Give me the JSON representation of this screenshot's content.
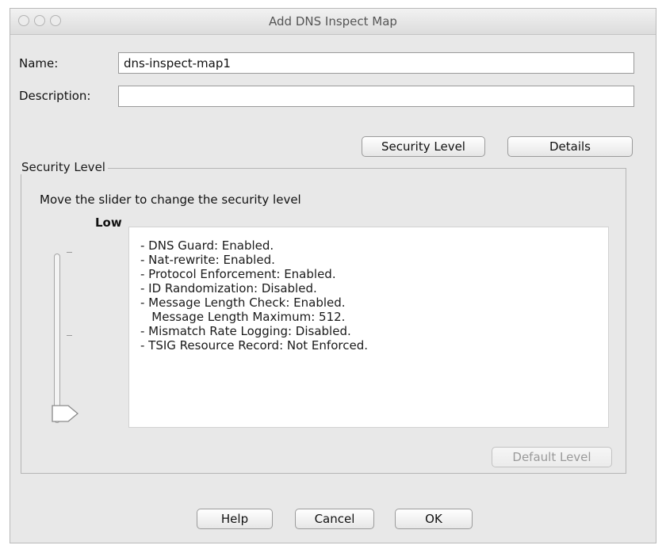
{
  "window": {
    "title": "Add DNS Inspect Map"
  },
  "form": {
    "name_label": "Name:",
    "name_value": "dns-inspect-map1",
    "description_label": "Description:",
    "description_value": ""
  },
  "toolbar": {
    "security_level_label": "Security Level",
    "details_label": "Details"
  },
  "security": {
    "legend": "Security Level",
    "instruction": "Move the slider to change the security level",
    "level": "Low",
    "lines": [
      "- DNS Guard: Enabled.",
      "- Nat-rewrite: Enabled.",
      "- Protocol Enforcement: Enabled.",
      "- ID Randomization: Disabled.",
      "- Message Length Check: Enabled.",
      "   Message Length Maximum: 512.",
      "- Mismatch Rate Logging: Disabled.",
      "- TSIG Resource Record: Not Enforced."
    ],
    "default_level_label": "Default Level"
  },
  "footer": {
    "help_label": "Help",
    "cancel_label": "Cancel",
    "ok_label": "OK"
  }
}
